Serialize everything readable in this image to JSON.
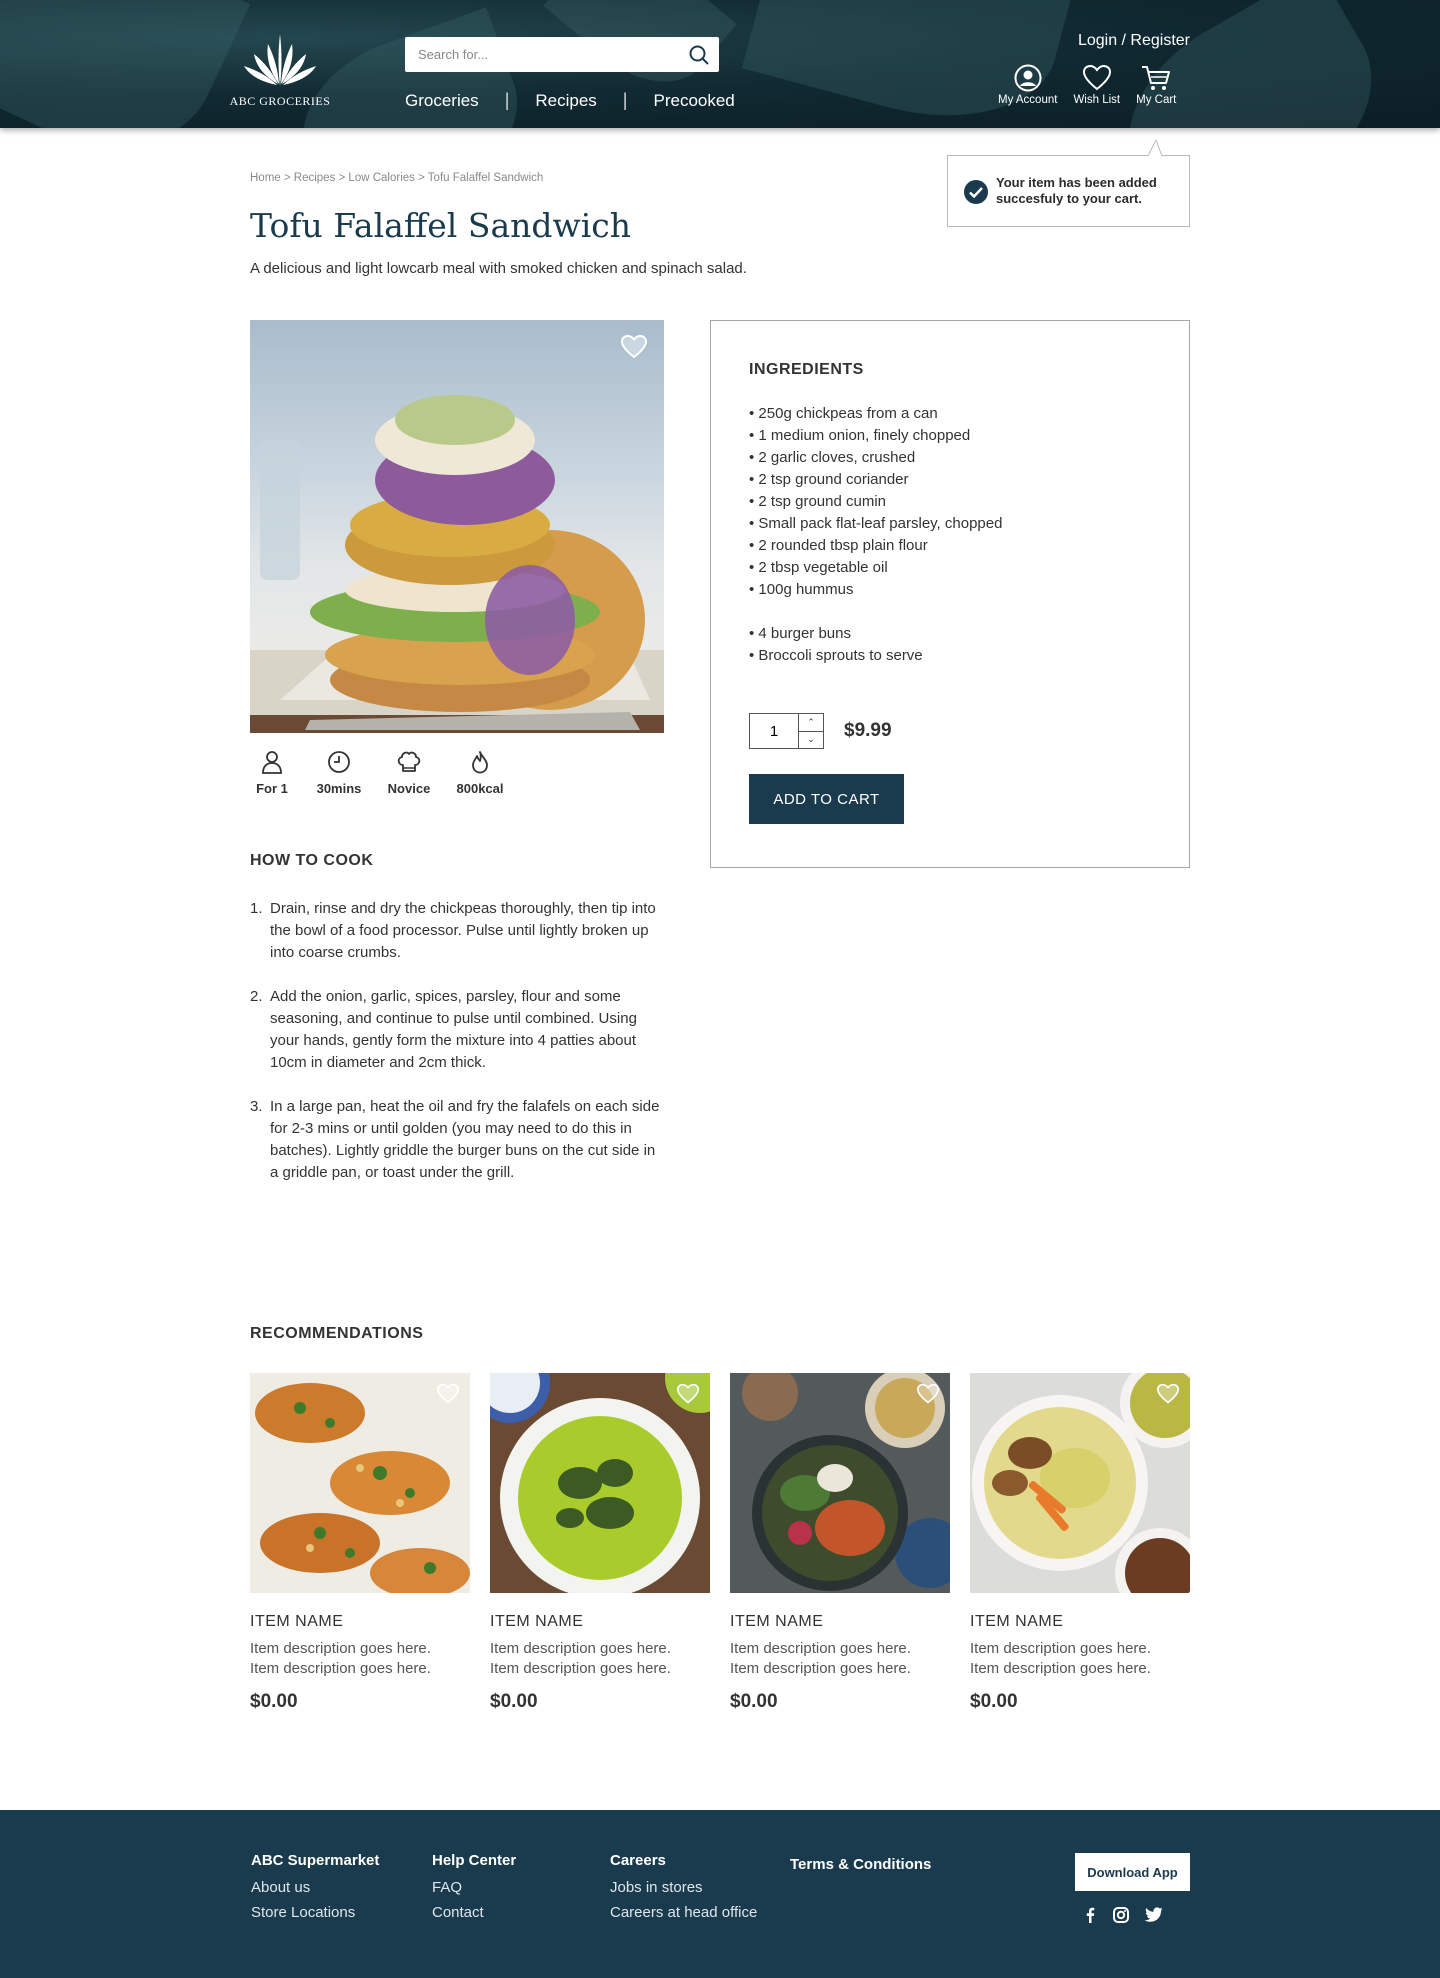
{
  "header": {
    "brand": "ABC GROCERIES",
    "search": {
      "placeholder": "Search for..."
    },
    "nav": [
      "Groceries",
      "Recipes",
      "Precooked"
    ],
    "login": "Login / Register",
    "icons": {
      "account": "My Account",
      "wishlist": "Wish List",
      "cart": "My Cart"
    }
  },
  "toast": {
    "message": "Your item has been added succesfuly to your cart."
  },
  "breadcrumb": "Home > Recipes > Low Calories > Tofu Falaffel Sandwich",
  "recipe": {
    "title": "Tofu Falaffel Sandwich",
    "subtitle": "A delicious and light lowcarb meal with smoked chicken and spinach salad.",
    "stats": [
      {
        "icon": "person-icon",
        "label": "For 1"
      },
      {
        "icon": "clock-icon",
        "label": "30mins"
      },
      {
        "icon": "chef-hat-icon",
        "label": "Novice"
      },
      {
        "icon": "flame-icon",
        "label": "800kcal"
      }
    ]
  },
  "howto": {
    "heading": "HOW TO COOK",
    "steps": [
      "Drain, rinse and dry the chickpeas thoroughly, then tip into the bowl of a food processor. Pulse until lightly broken up into coarse crumbs.",
      "Add the onion, garlic, spices, parsley, flour and some seasoning, and continue to pulse until combined. Using your hands, gently form the mixture into 4 patties about 10cm in diameter and 2cm thick.",
      "In a large pan, heat the oil and fry the falafels on each side for 2-3 mins or until golden (you may need to do this in batches). Lightly griddle the burger buns on the cut side in a griddle pan, or toast under the grill."
    ]
  },
  "ingredients": {
    "heading": "INGREDIENTS",
    "items": [
      "• 250g chickpeas from a can",
      "• 1 medium onion, finely chopped",
      "• 2 garlic cloves, crushed",
      "• 2 tsp ground coriander",
      "• 2 tsp ground cumin",
      "• Small pack flat-leaf parsley, chopped",
      "• 2 rounded tbsp plain flour",
      "• 2 tbsp vegetable oil",
      "• 100g hummus",
      "",
      "• 4 burger buns",
      "• Broccoli sprouts to serve"
    ],
    "quantity": "1",
    "price": "$9.99",
    "add_button": "ADD TO CART"
  },
  "recommendations": {
    "heading": "RECOMMENDATIONS",
    "items": [
      {
        "name": "ITEM NAME",
        "desc1": "Item description goes here.",
        "desc2": "Item description goes here.",
        "price": "$0.00"
      },
      {
        "name": "ITEM NAME",
        "desc1": "Item description goes here.",
        "desc2": "Item description goes here.",
        "price": "$0.00"
      },
      {
        "name": "ITEM NAME",
        "desc1": "Item description goes here.",
        "desc2": "Item description goes here.",
        "price": "$0.00"
      },
      {
        "name": "ITEM NAME",
        "desc1": "Item description goes here.",
        "desc2": "Item description goes here.",
        "price": "$0.00"
      }
    ]
  },
  "footer": {
    "columns": [
      {
        "heading": "ABC Supermarket",
        "links": [
          "About us",
          "Store Locations"
        ]
      },
      {
        "heading": "Help Center",
        "links": [
          "FAQ",
          "Contact"
        ]
      },
      {
        "heading": "Careers",
        "links": [
          "Jobs in stores",
          "Careers at head office"
        ]
      },
      {
        "heading": "Terms & Conditions",
        "links": []
      }
    ],
    "download": "Download App",
    "social": [
      "facebook-icon",
      "instagram-icon",
      "twitter-icon"
    ]
  },
  "colors": {
    "primary": "#1a3a4d",
    "header_bg": "#112a33",
    "border": "#a7a7a7"
  }
}
